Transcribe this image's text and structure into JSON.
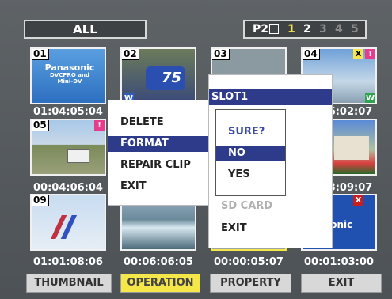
{
  "topbar": {
    "filter_label": "ALL",
    "p2_label": "P2",
    "slots": [
      "1",
      "2",
      "3",
      "4",
      "5"
    ]
  },
  "clips": [
    {
      "num": "01",
      "tc": "01:04:05:04",
      "logo": [
        "Panasonic",
        "DVCPRO and",
        "Mini-DV"
      ]
    },
    {
      "num": "02",
      "tc": ""
    },
    {
      "num": "03",
      "tc": ""
    },
    {
      "num": "04",
      "tc": "6:02:07"
    },
    {
      "num": "05",
      "tc": "00:04:06:04"
    },
    {
      "num": "",
      "tc": ""
    },
    {
      "num": "",
      "tc": ""
    },
    {
      "num": "",
      "tc": "3:09:07"
    },
    {
      "num": "09",
      "tc": "01:01:08:06"
    },
    {
      "num": "",
      "tc": "00:06:06:05"
    },
    {
      "num": "",
      "tc": "00:00:05:07"
    },
    {
      "num": "",
      "tc": "00:01:03:00",
      "logo": [
        "asonic"
      ]
    }
  ],
  "badges": {
    "thumb2": "W",
    "thumb4_x": "X",
    "thumb4_bang": "!",
    "thumb4_w": "W",
    "thumb5_bang": "!",
    "thumb12_x": "X",
    "thumb2_number": "75"
  },
  "operation_menu": {
    "items": [
      "DELETE",
      "FORMAT",
      "REPAIR CLIP",
      "EXIT"
    ],
    "selected": 1
  },
  "slot_menu": {
    "header": "SLOT1",
    "sd_card": "SD CARD",
    "exit": "EXIT"
  },
  "confirm": {
    "title": "SURE?",
    "no": "NO",
    "yes": "YES",
    "selected": "NO"
  },
  "bottom_buttons": [
    "THUMBNAIL",
    "OPERATION",
    "PROPERTY",
    "EXIT"
  ],
  "active_bottom": "OPERATION",
  "colors": {
    "frame": "#555b5e",
    "selected": "#2e3a8a",
    "accent_yellow": "#f5e64a",
    "flag_yellow": "#f5e64a",
    "flag_pink": "#e73c8b",
    "flag_red": "#c81e1e",
    "flag_green": "#2ea44f",
    "flag_blue": "#2e5cc2"
  }
}
